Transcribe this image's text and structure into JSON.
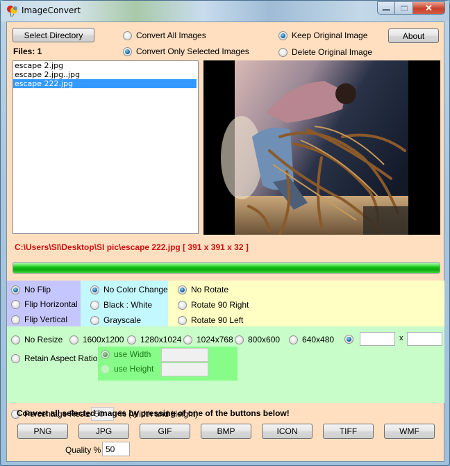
{
  "window": {
    "title": "ImageConvert",
    "icon": "balloons-icon",
    "controls": {
      "minimize": "minimize-icon",
      "maximize": "maximize-icon",
      "close": "close-icon"
    }
  },
  "top": {
    "select_directory_label": "Select Directory",
    "files_label": "Files: 1",
    "about_label": "About",
    "convert_scope": [
      {
        "label": "Convert All Images",
        "checked": false
      },
      {
        "label": "Convert Only Selected Images",
        "checked": true
      }
    ],
    "original_handling": [
      {
        "label": "Keep Original Image",
        "checked": true
      },
      {
        "label": "Delete Original Image",
        "checked": false
      }
    ]
  },
  "file_list": {
    "items": [
      {
        "name": "escape 2.jpg",
        "selected": false
      },
      {
        "name": "escape 2.jpg..jpg",
        "selected": false
      },
      {
        "name": "escape 222.jpg",
        "selected": true
      }
    ]
  },
  "preview": {
    "description": "Artwork of a man in pink shirt and jeans leaning back, entangled in tree roots against a dark sky"
  },
  "status": {
    "path_info": "C:\\Users\\SI\\Desktop\\SI pic\\escape 222.jpg [ 391 x 391 x 32 ]",
    "progress_percent": 100
  },
  "colors": {
    "path_text": "#cc1111",
    "flip_panel": "#c6c6ff",
    "color_panel": "#c4f8ff",
    "rotate_panel": "#ffffc4",
    "resize_panel": "#c8fcc8",
    "aspect_panel": "#88fc88",
    "client_bg": "#ffdfc0",
    "progress": "#16c016"
  },
  "flip": [
    {
      "label": "No Flip",
      "checked": true
    },
    {
      "label": "Flip Horizontal",
      "checked": false
    },
    {
      "label": "Flip Vertical",
      "checked": false
    }
  ],
  "color_change": [
    {
      "label": "No Color Change",
      "checked": true
    },
    {
      "label": "Black : White",
      "checked": false
    },
    {
      "label": "Grayscale",
      "checked": false
    }
  ],
  "rotate": [
    {
      "label": "No Rotate",
      "checked": true
    },
    {
      "label": "Rotate 90 Right",
      "checked": false
    },
    {
      "label": "Rotate 90 Left",
      "checked": false
    }
  ],
  "resize": {
    "presets": [
      {
        "label": "No Resize",
        "checked": false
      },
      {
        "label": "1600x1200",
        "checked": false
      },
      {
        "label": "1280x1024",
        "checked": false
      },
      {
        "label": "1024x768",
        "checked": false
      },
      {
        "label": "800x600",
        "checked": false
      },
      {
        "label": "640x480",
        "checked": false
      }
    ],
    "custom": {
      "checked": true,
      "width_value": "",
      "height_value": "",
      "separator": "x"
    },
    "retain_aspect": {
      "label": "Retain Aspect Ratio",
      "checked": false
    },
    "use_width": {
      "label": "use Width",
      "checked": true,
      "value": ""
    },
    "use_height": {
      "label": "use Height",
      "checked": false,
      "value": ""
    },
    "percentage": {
      "label": "Percentage Resize",
      "checked": false,
      "value": "50",
      "suffix": "% (Width and Height)"
    }
  },
  "convert": {
    "message": "Convert all selected images by pressing of one of the buttons below!",
    "formats": [
      "PNG",
      "JPG",
      "GIF",
      "BMP",
      "ICON",
      "TIFF",
      "WMF"
    ],
    "quality_label": "Quality %",
    "quality_value": "50"
  }
}
